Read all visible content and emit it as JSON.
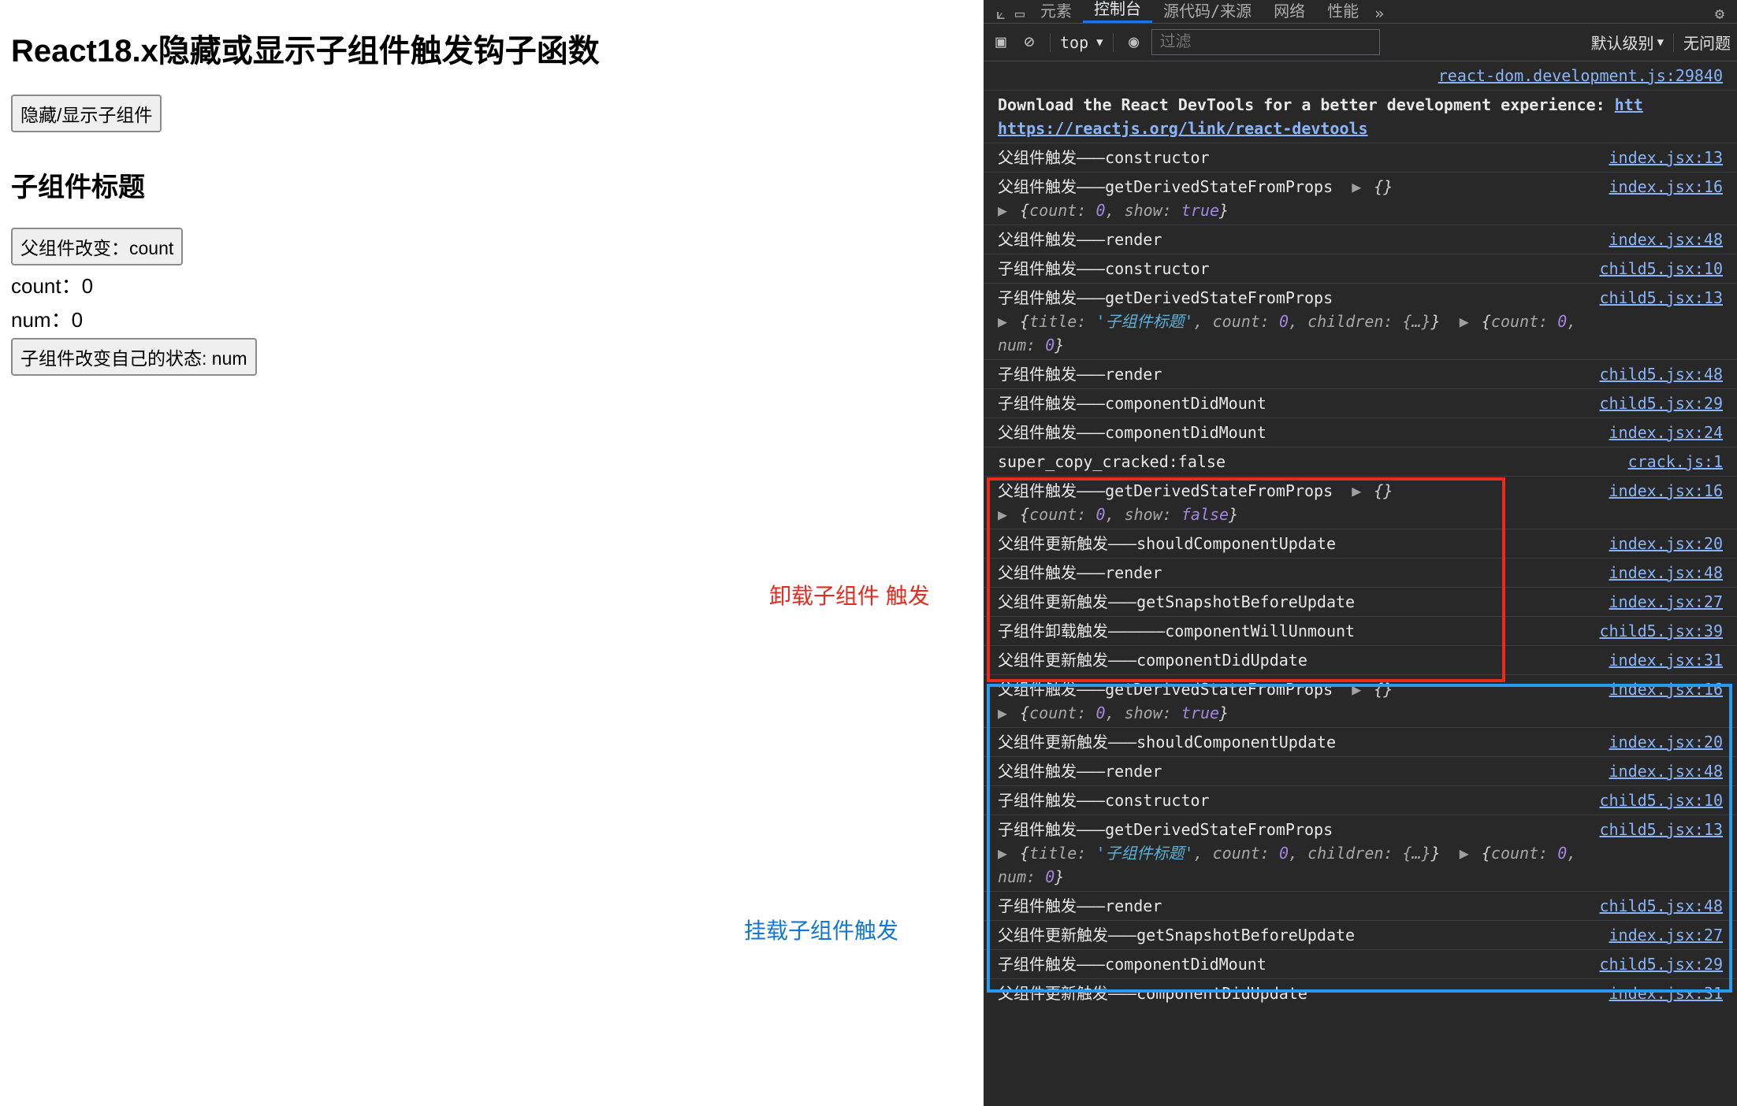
{
  "app": {
    "title": "React18.x隐藏或显示子组件触发钩子函数",
    "toggle_btn": "隐藏/显示子组件",
    "child_title": "子组件标题",
    "parent_change_btn": "父组件改变：count",
    "count_line": "count：0",
    "num_line": "num：0",
    "child_change_btn": "子组件改变自己的状态: num"
  },
  "annotations": {
    "unmount": "卸载子组件 触发",
    "mount": "挂载子组件触发"
  },
  "devtools": {
    "tabs": [
      "元素",
      "控制台",
      "源代码/来源",
      "网络",
      "性能"
    ],
    "active_tab": 1,
    "top_label": "top",
    "filter_placeholder": "过滤",
    "level_label": "默认级别",
    "issues_label": "无问题",
    "first_src": "react-dom.development.js:29840",
    "msg0a": "Download the React DevTools for a better development experience: ",
    "msg0b": "https://reactjs.org/link/react-devtools",
    "msg0url": "htt",
    "rows": [
      {
        "text": "父组件触发———constructor",
        "src": "index.jsx:13"
      },
      {
        "text": "父组件触发———getDerivedStateFromProps",
        "expand": true,
        "obj": "{}",
        "src": "index.jsx:16",
        "sub": "{count: 0, show: true}"
      },
      {
        "text": "父组件触发———render",
        "src": "index.jsx:48"
      },
      {
        "text": "子组件触发———constructor",
        "src": "child5.jsx:10"
      },
      {
        "text": "子组件触发———getDerivedStateFromProps",
        "src": "child5.jsx:13",
        "sub2": true
      },
      {
        "text": "子组件触发———render",
        "src": "child5.jsx:48"
      },
      {
        "text": "子组件触发———componentDidMount",
        "src": "child5.jsx:29"
      },
      {
        "text": "父组件触发———componentDidMount",
        "src": "index.jsx:24"
      },
      {
        "text": "super_copy_cracked:false",
        "src": "crack.js:1"
      },
      {
        "text": "父组件触发———getDerivedStateFromProps",
        "expand": true,
        "obj": "{}",
        "src": "index.jsx:16",
        "sub": "{count: 0, show: false}"
      },
      {
        "text": "父组件更新触发———shouldComponentUpdate",
        "src": "index.jsx:20"
      },
      {
        "text": "父组件触发———render",
        "src": "index.jsx:48"
      },
      {
        "text": "父组件更新触发———getSnapshotBeforeUpdate",
        "src": "index.jsx:27"
      },
      {
        "text": "子组件卸载触发——————componentWillUnmount",
        "src": "child5.jsx:39"
      },
      {
        "text": "父组件更新触发———componentDidUpdate",
        "src": "index.jsx:31"
      },
      {
        "text": "父组件触发———getDerivedStateFromProps",
        "expand": true,
        "obj": "{}",
        "src": "index.jsx:16",
        "sub": "{count: 0, show: true}"
      },
      {
        "text": "父组件更新触发———shouldComponentUpdate",
        "src": "index.jsx:20"
      },
      {
        "text": "父组件触发———render",
        "src": "index.jsx:48"
      },
      {
        "text": "子组件触发———constructor",
        "src": "child5.jsx:10"
      },
      {
        "text": "子组件触发———getDerivedStateFromProps",
        "src": "child5.jsx:13",
        "sub2": true
      },
      {
        "text": "子组件触发———render",
        "src": "child5.jsx:48"
      },
      {
        "text": "父组件更新触发———getSnapshotBeforeUpdate",
        "src": "index.jsx:27"
      },
      {
        "text": "子组件触发———componentDidMount",
        "src": "child5.jsx:29"
      },
      {
        "text": "父组件更新触发———componentDidUpdate",
        "src": "index.jsx:31"
      }
    ],
    "sub2_a": "{title: '子组件标题', count: 0, children: {…}}",
    "sub2_b": "{count: 0, num: 0}"
  }
}
